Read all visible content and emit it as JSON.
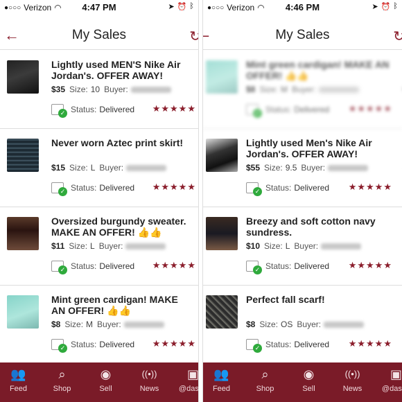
{
  "left": {
    "status_bar": {
      "carrier": "Verizon",
      "time": "4:47 PM"
    },
    "nav": {
      "title": "My Sales"
    },
    "items": [
      {
        "title": "Lightly used MEN'S Nike Air Jordan's. OFFER AWAY!",
        "price": "$35",
        "size_label": "Size:",
        "size": "10",
        "buyer_label": "Buyer:",
        "status_label": "Status:",
        "status": "Delivered",
        "rating": 5
      },
      {
        "title": "Never worn Aztec print skirt!",
        "price": "$15",
        "size_label": "Size:",
        "size": "L",
        "buyer_label": "Buyer:",
        "status_label": "Status:",
        "status": "Delivered",
        "rating": 5
      },
      {
        "title": "Oversized burgundy sweater. MAKE AN OFFER! 👍👍",
        "price": "$11",
        "size_label": "Size:",
        "size": "L",
        "buyer_label": "Buyer:",
        "status_label": "Status:",
        "status": "Delivered",
        "rating": 5
      },
      {
        "title": "Mint green cardigan! MAKE AN OFFER! 👍👍",
        "price": "$8",
        "size_label": "Size:",
        "size": "M",
        "buyer_label": "Buyer:",
        "status_label": "Status:",
        "status": "Delivered",
        "rating": 5
      }
    ],
    "tabs": [
      {
        "label": "Feed",
        "icon": "people-icon"
      },
      {
        "label": "Shop",
        "icon": "search-icon"
      },
      {
        "label": "Sell",
        "icon": "camera-icon"
      },
      {
        "label": "News",
        "icon": "broadcast-icon"
      },
      {
        "label": "@dasbo",
        "icon": "profile-card-icon"
      }
    ]
  },
  "right": {
    "status_bar": {
      "carrier": "Verizon",
      "time": "4:46 PM"
    },
    "nav": {
      "title": "My Sales"
    },
    "items": [
      {
        "title": "Mint green cardigan! MAKE AN OFFER! 👍👍",
        "price": "$8",
        "size_label": "Size:",
        "size": "M",
        "buyer_label": "Buyer:",
        "status_label": "Status:",
        "status": "Delivered",
        "rating": 5
      },
      {
        "title": "Lightly used Men's Nike Air Jordan's. OFFER AWAY!",
        "price": "$55",
        "size_label": "Size:",
        "size": "9.5",
        "buyer_label": "Buyer:",
        "status_label": "Status:",
        "status": "Delivered",
        "rating": 5
      },
      {
        "title": "Breezy and soft cotton navy sundress.",
        "price": "$10",
        "size_label": "Size:",
        "size": "L",
        "buyer_label": "Buyer:",
        "status_label": "Status:",
        "status": "Delivered",
        "rating": 5
      },
      {
        "title": "Perfect fall scarf!",
        "price": "$8",
        "size_label": "Size:",
        "size": "OS",
        "buyer_label": "Buyer:",
        "status_label": "Status:",
        "status": "Delivered",
        "rating": 5
      }
    ],
    "tabs": [
      {
        "label": "Feed",
        "icon": "people-icon"
      },
      {
        "label": "Shop",
        "icon": "search-icon"
      },
      {
        "label": "Sell",
        "icon": "camera-icon"
      },
      {
        "label": "News",
        "icon": "broadcast-icon"
      },
      {
        "label": "@dasbo",
        "icon": "profile-card-icon"
      }
    ]
  },
  "colors": {
    "accent": "#8b1e2c",
    "tabbar": "#7a1b28",
    "delivered_check": "#2faa3c"
  }
}
